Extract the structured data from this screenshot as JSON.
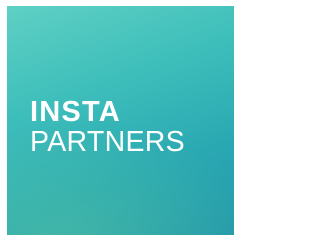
{
  "brand": {
    "line1": "INSTA",
    "line2": "PARTNERS"
  },
  "colors": {
    "gradient_start": "#5fd0c4",
    "gradient_end": "#2097ab",
    "text": "#ffffff",
    "background": "#ffffff"
  }
}
